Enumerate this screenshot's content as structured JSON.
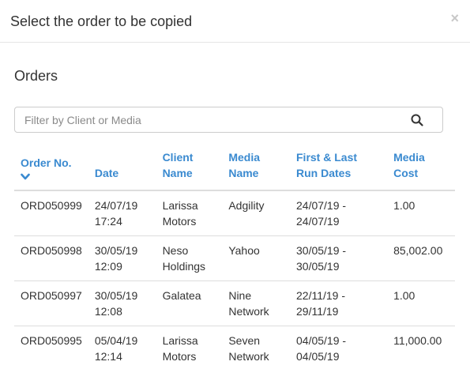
{
  "modal": {
    "title": "Select the order to be copied",
    "close_label": "×"
  },
  "section": {
    "title": "Orders"
  },
  "filter": {
    "placeholder": "Filter by Client or Media",
    "value": ""
  },
  "table": {
    "headers": {
      "order_no": "Order No.",
      "date": "Date",
      "client_name": "Client Name",
      "media_name": "Media Name",
      "run_dates": "First & Last Run Dates",
      "media_cost": "Media Cost"
    },
    "rows": [
      {
        "order_no": "ORD050999",
        "date": "24/07/19 17:24",
        "client": "Larissa Motors",
        "media": "Adgility",
        "run_dates": "24/07/19 - 24/07/19",
        "cost": "1.00"
      },
      {
        "order_no": "ORD050998",
        "date": "30/05/19 12:09",
        "client": "Neso Holdings",
        "media": "Yahoo",
        "run_dates": "30/05/19 - 30/05/19",
        "cost": "85,002.00"
      },
      {
        "order_no": "ORD050997",
        "date": "30/05/19 12:08",
        "client": "Galatea",
        "media": "Nine Network",
        "run_dates": "22/11/19 - 29/11/19",
        "cost": "1.00"
      },
      {
        "order_no": "ORD050995",
        "date": "05/04/19 12:14",
        "client": "Larissa Motors",
        "media": "Seven Network",
        "run_dates": "04/05/19 - 04/05/19",
        "cost": "11,000.00"
      }
    ]
  },
  "icons": {
    "close": "close-icon",
    "search": "search-icon",
    "sort": "chevron-down-icon"
  },
  "colors": {
    "header_link": "#3a8ad0",
    "text": "#333333",
    "border": "#dddddd"
  }
}
